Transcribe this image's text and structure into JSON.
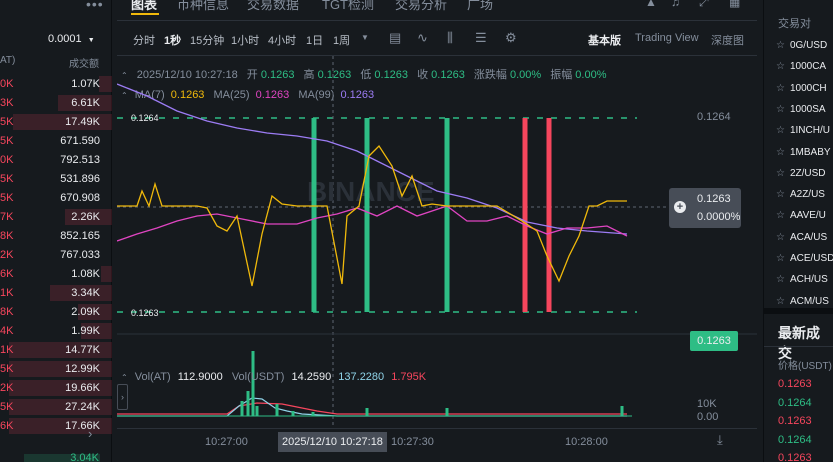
{
  "left": {
    "header_amount": "AT)",
    "header_total": "成交额",
    "price_select": "0.0001",
    "rows": [
      {
        "a": "0K",
        "t": "1.07K",
        "fill": 0.12
      },
      {
        "a": "3K",
        "t": "6.61K",
        "fill": 0.48
      },
      {
        "a": "5K",
        "t": "17.49K",
        "fill": 0.88
      },
      {
        "a": "5K",
        "t": "671.590",
        "fill": 0.0
      },
      {
        "a": "0K",
        "t": "792.513",
        "fill": 0.0
      },
      {
        "a": "5K",
        "t": "531.896",
        "fill": 0.0
      },
      {
        "a": "5K",
        "t": "670.908",
        "fill": 0.0
      },
      {
        "a": "7K",
        "t": "2.26K",
        "fill": 0.42
      },
      {
        "a": "8K",
        "t": "852.165",
        "fill": 0.0
      },
      {
        "a": "2K",
        "t": "767.033",
        "fill": 0.0
      },
      {
        "a": "6K",
        "t": "1.08K",
        "fill": 0.1
      },
      {
        "a": "1K",
        "t": "3.34K",
        "fill": 0.55
      },
      {
        "a": "8K",
        "t": "2.09K",
        "fill": 0.3
      },
      {
        "a": "4K",
        "t": "1.99K",
        "fill": 0.28
      },
      {
        "a": "1K",
        "t": "14.77K",
        "fill": 0.92
      },
      {
        "a": "5K",
        "t": "12.99K",
        "fill": 0.92
      },
      {
        "a": "2K",
        "t": "19.66K",
        "fill": 0.92
      },
      {
        "a": "5K",
        "t": "27.24K",
        "fill": 0.92
      },
      {
        "a": "6K",
        "t": "17.66K",
        "fill": 0.92
      }
    ],
    "last": "3.04K"
  },
  "center": {
    "tabs": [
      "图表",
      "币种信息",
      "交易数据",
      "TGT检测",
      "交易分析",
      "广场"
    ],
    "timeframes": [
      "分时",
      "1秒",
      "15分钟",
      "1小时",
      "4小时",
      "1日",
      "1周"
    ],
    "active_timeframe": "1秒",
    "views": [
      "基本版",
      "Trading View",
      "深度图"
    ],
    "ohlc": {
      "date": "2025/12/10 10:27:18",
      "open_label": "开",
      "open": "0.1263",
      "high_label": "高",
      "high": "0.1263",
      "low_label": "低",
      "low": "0.1263",
      "close_label": "收",
      "close": "0.1263",
      "change_label": "涨跌幅",
      "change": "0.00%",
      "amp_label": "振幅",
      "amp": "0.00%"
    },
    "ma": {
      "ma7_label": "MA(7)",
      "ma7": "0.1263",
      "ma25_label": "MA(25)",
      "ma25": "0.1263",
      "ma99_label": "MA(99)",
      "ma99": "0.1263"
    },
    "price_axis": {
      "top": "0.1264",
      "current": "0.1263",
      "change": "0.0000%",
      "last": "0.1263"
    },
    "hi_label": "0.1264",
    "lo_label": "0.1263",
    "watermark": "BINANCE",
    "vol": {
      "label1": "Vol(AT)",
      "v1": "112.9000",
      "label2": "Vol(USDT)",
      "v2": "14.2590",
      "v3": "137.2280",
      "v4": "1.795K",
      "axis_top": "10K",
      "axis_bottom": "0.00"
    },
    "time_axis": [
      "10:27:00",
      "10:27:30",
      "10:28:00"
    ],
    "crosshair_time": "2025/12/10 10:27:18",
    "colors": {
      "up": "#2ebd85",
      "down": "#f6465d",
      "ma7": "#f0b90b",
      "ma25": "#e045c2",
      "ma99": "#9c7cf4"
    }
  },
  "right": {
    "header": "交易对",
    "pairs": [
      "0G/USD",
      "1000CA",
      "1000CH",
      "1000SA",
      "1INCH/U",
      "1MBABY",
      "2Z/USD",
      "A2Z/US",
      "AAVE/U",
      "ACA/US",
      "ACE/USD",
      "ACH/US",
      "ACM/US"
    ],
    "trades_title": "最新成交",
    "price_header": "价格(USDT)",
    "trades": [
      {
        "p": "0.1263",
        "side": "down"
      },
      {
        "p": "0.1264",
        "side": "up"
      },
      {
        "p": "0.1263",
        "side": "down"
      },
      {
        "p": "0.1264",
        "side": "up"
      },
      {
        "p": "0.1263",
        "side": "down"
      }
    ]
  }
}
